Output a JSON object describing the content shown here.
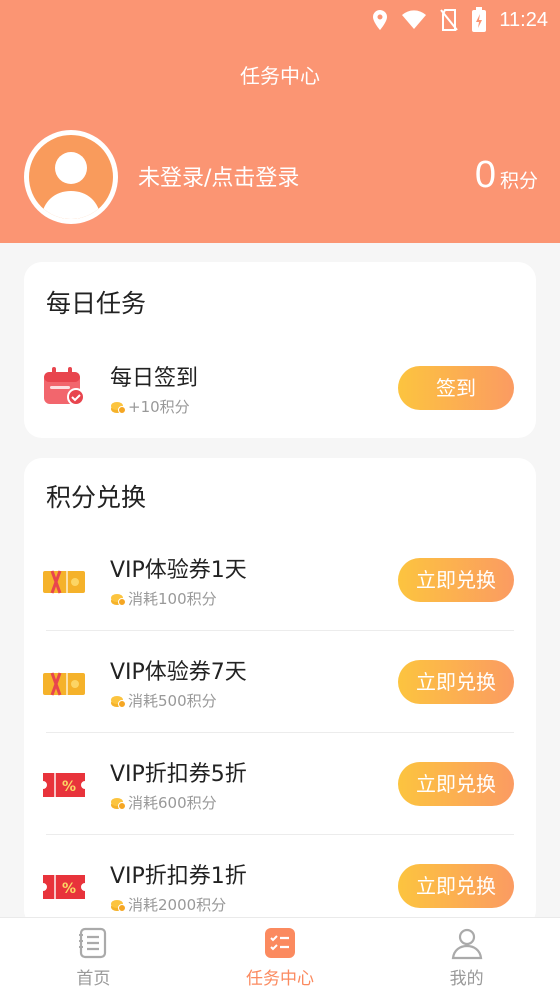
{
  "status_bar": {
    "time": "11:24"
  },
  "header": {
    "title": "任务中心",
    "login_text": "未登录/点击登录",
    "points_value": "0",
    "points_unit": "积分"
  },
  "daily": {
    "title": "每日任务",
    "tasks": [
      {
        "name": "每日签到",
        "reward": "+10积分",
        "button": "签到"
      }
    ]
  },
  "exchange": {
    "title": "积分兑换",
    "items": [
      {
        "name": "VIP体验券1天",
        "cost": "消耗100积分",
        "button": "立即兑换"
      },
      {
        "name": "VIP体验券7天",
        "cost": "消耗500积分",
        "button": "立即兑换"
      },
      {
        "name": "VIP折扣券5折",
        "cost": "消耗600积分",
        "button": "立即兑换"
      },
      {
        "name": "VIP折扣券1折",
        "cost": "消耗2000积分",
        "button": "立即兑换"
      }
    ]
  },
  "tabbar": {
    "tabs": [
      {
        "label": "首页",
        "icon": "home-book-icon"
      },
      {
        "label": "任务中心",
        "icon": "task-list-icon"
      },
      {
        "label": "我的",
        "icon": "user-icon"
      }
    ],
    "active": 1
  },
  "colors": {
    "header_bg": "#fb9573",
    "button_gradient_start": "#fcc43f",
    "button_gradient_end": "#fb9b62",
    "active_tab": "#fb8a5f"
  }
}
